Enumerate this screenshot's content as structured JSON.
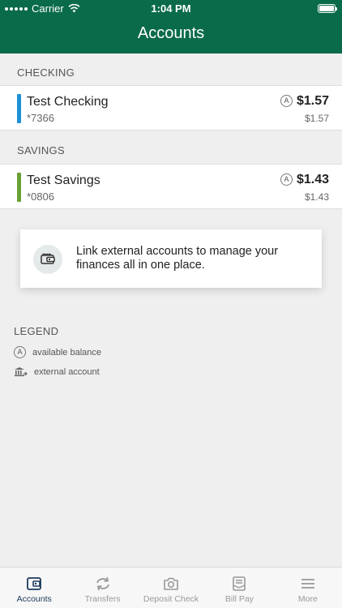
{
  "status_bar": {
    "carrier": "Carrier",
    "time": "1:04 PM"
  },
  "header": {
    "title": "Accounts"
  },
  "sections": {
    "checking": {
      "label": "CHECKING",
      "account": {
        "name": "Test Checking",
        "number": "*7366",
        "balance": "$1.57",
        "sub_balance": "$1.57",
        "balance_marker": "A",
        "color": "#1e90d6"
      }
    },
    "savings": {
      "label": "SAVINGS",
      "account": {
        "name": "Test Savings",
        "number": "*0806",
        "balance": "$1.43",
        "sub_balance": "$1.43",
        "balance_marker": "A",
        "color": "#6aa034"
      }
    }
  },
  "link_card": {
    "text": "Link external accounts to manage your finances all in one place.",
    "icon": "wallet-icon"
  },
  "legend": {
    "title": "LEGEND",
    "items": [
      {
        "icon": "available-balance-icon",
        "marker": "A",
        "label": "available balance"
      },
      {
        "icon": "bank-icon",
        "label": "external account"
      }
    ]
  },
  "tabbar": {
    "tabs": [
      {
        "label": "Accounts",
        "icon": "wallet-icon",
        "active": true
      },
      {
        "label": "Transfers",
        "icon": "transfer-icon"
      },
      {
        "label": "Deposit Check",
        "icon": "camera-icon"
      },
      {
        "label": "Bill Pay",
        "icon": "bill-icon"
      },
      {
        "label": "More",
        "icon": "menu-icon"
      }
    ]
  },
  "colors": {
    "header": "#0a6b4a",
    "tab_active": "#1b3a5b",
    "checking_bar": "#1e90d6",
    "savings_bar": "#6aa034"
  }
}
